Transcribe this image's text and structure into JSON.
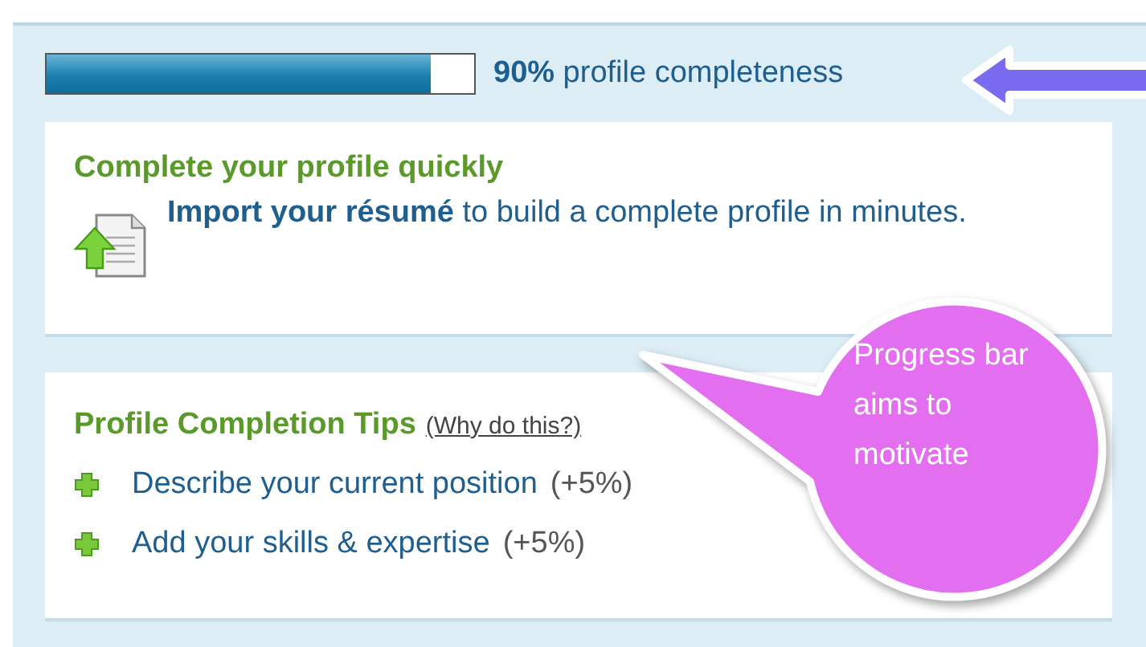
{
  "progress": {
    "level": 0.9,
    "percent": "90%",
    "label": "profile completeness"
  },
  "quick": {
    "title": "Complete your profile quickly",
    "link": "Import your résumé",
    "text": "to build a complete profile in minutes."
  },
  "tips": {
    "title": "Profile Completion Tips",
    "why": "(Why do this?)",
    "items": [
      {
        "label": "Describe your current position",
        "gain": "(+5%)"
      },
      {
        "label": "Add your skills & expertise",
        "gain": "(+5%)"
      }
    ]
  },
  "callout": {
    "text": "Progress bar aims to motivate"
  }
}
